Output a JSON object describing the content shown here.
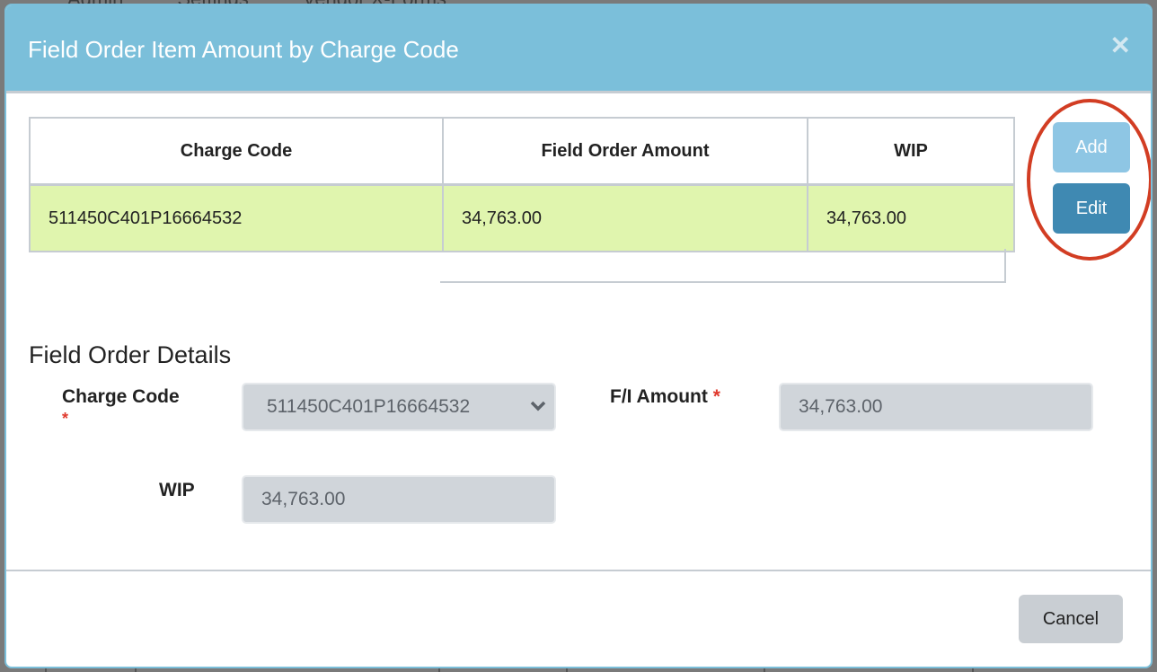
{
  "background": {
    "nav_items": [
      "Admin",
      "Settings",
      "Vendor X-Forms"
    ]
  },
  "modal": {
    "title": "Field Order Item Amount by Charge Code",
    "close_icon": "close-icon",
    "table": {
      "columns": [
        "Charge Code",
        "Field Order Amount",
        "WIP"
      ],
      "rows": [
        {
          "charge_code": "511450C401P16664532",
          "field_order_amount": "34,763.00",
          "wip": "34,763.00",
          "selected": true
        }
      ]
    },
    "actions": {
      "add_label": "Add",
      "edit_label": "Edit"
    },
    "details": {
      "title": "Field Order Details",
      "charge_code_label": "Charge Code",
      "charge_code_value": "511450C401P16664532",
      "fi_amount_label": "F/I Amount",
      "fi_amount_value": "34,763.00",
      "wip_label": "WIP",
      "wip_value": "34,763.00",
      "required_mark": "*"
    },
    "footer": {
      "cancel_label": "Cancel"
    }
  },
  "colors": {
    "header": "#7bbfda",
    "selected_row": "#e0f5ae",
    "add_button": "#8ec6e4",
    "edit_button": "#3f89b2",
    "annotation": "#d23d23",
    "required": "#e03a2e"
  }
}
